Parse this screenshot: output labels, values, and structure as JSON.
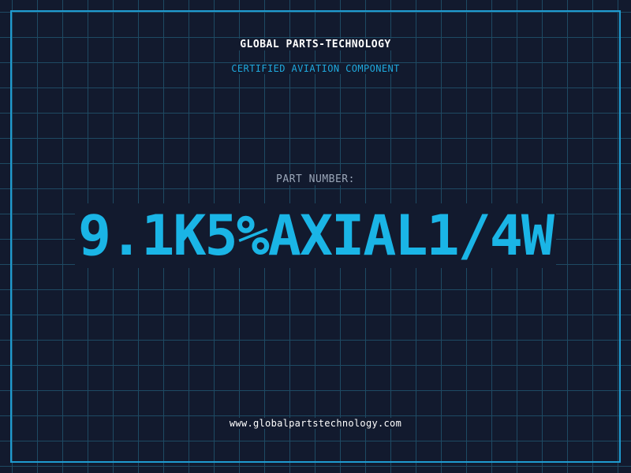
{
  "header": {
    "company": "GLOBAL PARTS-TECHNOLOGY",
    "subtitle": "CERTIFIED AVIATION COMPONENT"
  },
  "part": {
    "label": "PART NUMBER:",
    "number": "9.1K5%AXIAL1/4W"
  },
  "footer": {
    "website": "www.globalpartstechnology.com"
  },
  "colors": {
    "background": "#121a2e",
    "grid": "#1e4a63",
    "frame": "#1f9bd0",
    "accent": "#1ab5e6",
    "label": "#9aa6b8",
    "text": "#ffffff"
  }
}
